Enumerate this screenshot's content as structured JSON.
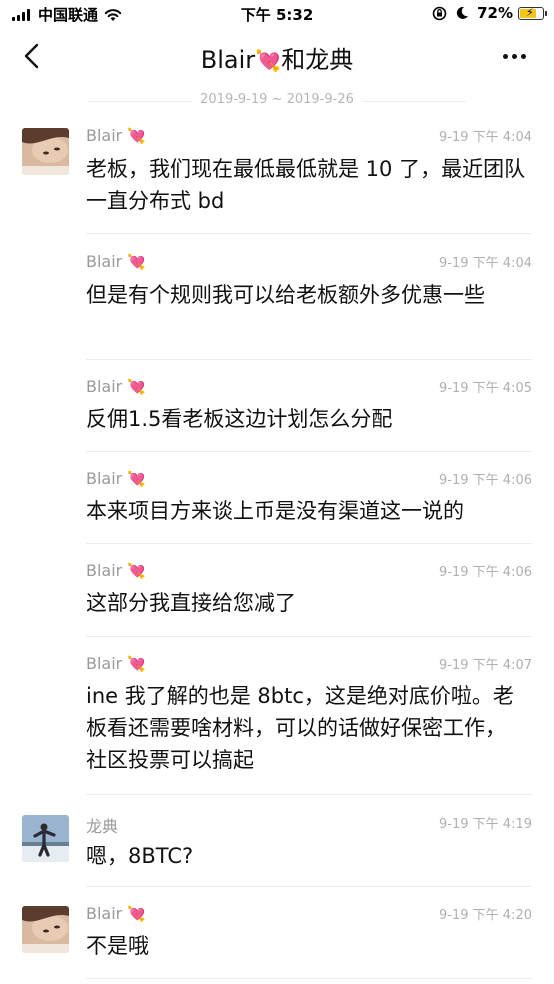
{
  "status_bar": {
    "carrier": "中国联通",
    "time": "下午 5:32",
    "battery": "72%"
  },
  "header": {
    "contact": "Blair",
    "connector": "和龙典",
    "heart_icon": "💘",
    "date_range": "2019-9-19 ~ 2019-9-26"
  },
  "messages": [
    {
      "sender": "Blair",
      "time": "9-19 下午 4:04",
      "text": "老板，我们现在最低最低就是 10 了，最近团队一直分布式 bd"
    },
    {
      "sender": "Blair",
      "time": "9-19 下午 4:04",
      "text": "但是有个规则我可以给老板额外多优惠一些"
    },
    {
      "sender": "Blair",
      "time": "9-19 下午 4:05",
      "text": "反佣1.5看老板这边计划怎么分配"
    },
    {
      "sender": "Blair",
      "time": "9-19 下午 4:06",
      "text": "本来项目方来谈上币是没有渠道这一说的"
    },
    {
      "sender": "Blair",
      "time": "9-19 下午 4:06",
      "text": "这部分我直接给您减了"
    },
    {
      "sender": "Blair",
      "time": "9-19 下午 4:07",
      "text": "ine 我了解的也是 8btc，这是绝对底价啦。老板看还需要啥材料，可以的话做好保密工作，社区投票可以搞起"
    },
    {
      "sender": "龙典",
      "time": "9-19 下午 4:19",
      "text": "嗯，8BTC?"
    },
    {
      "sender": "Blair",
      "time": "9-19 下午 4:20",
      "text": "不是哦"
    }
  ]
}
